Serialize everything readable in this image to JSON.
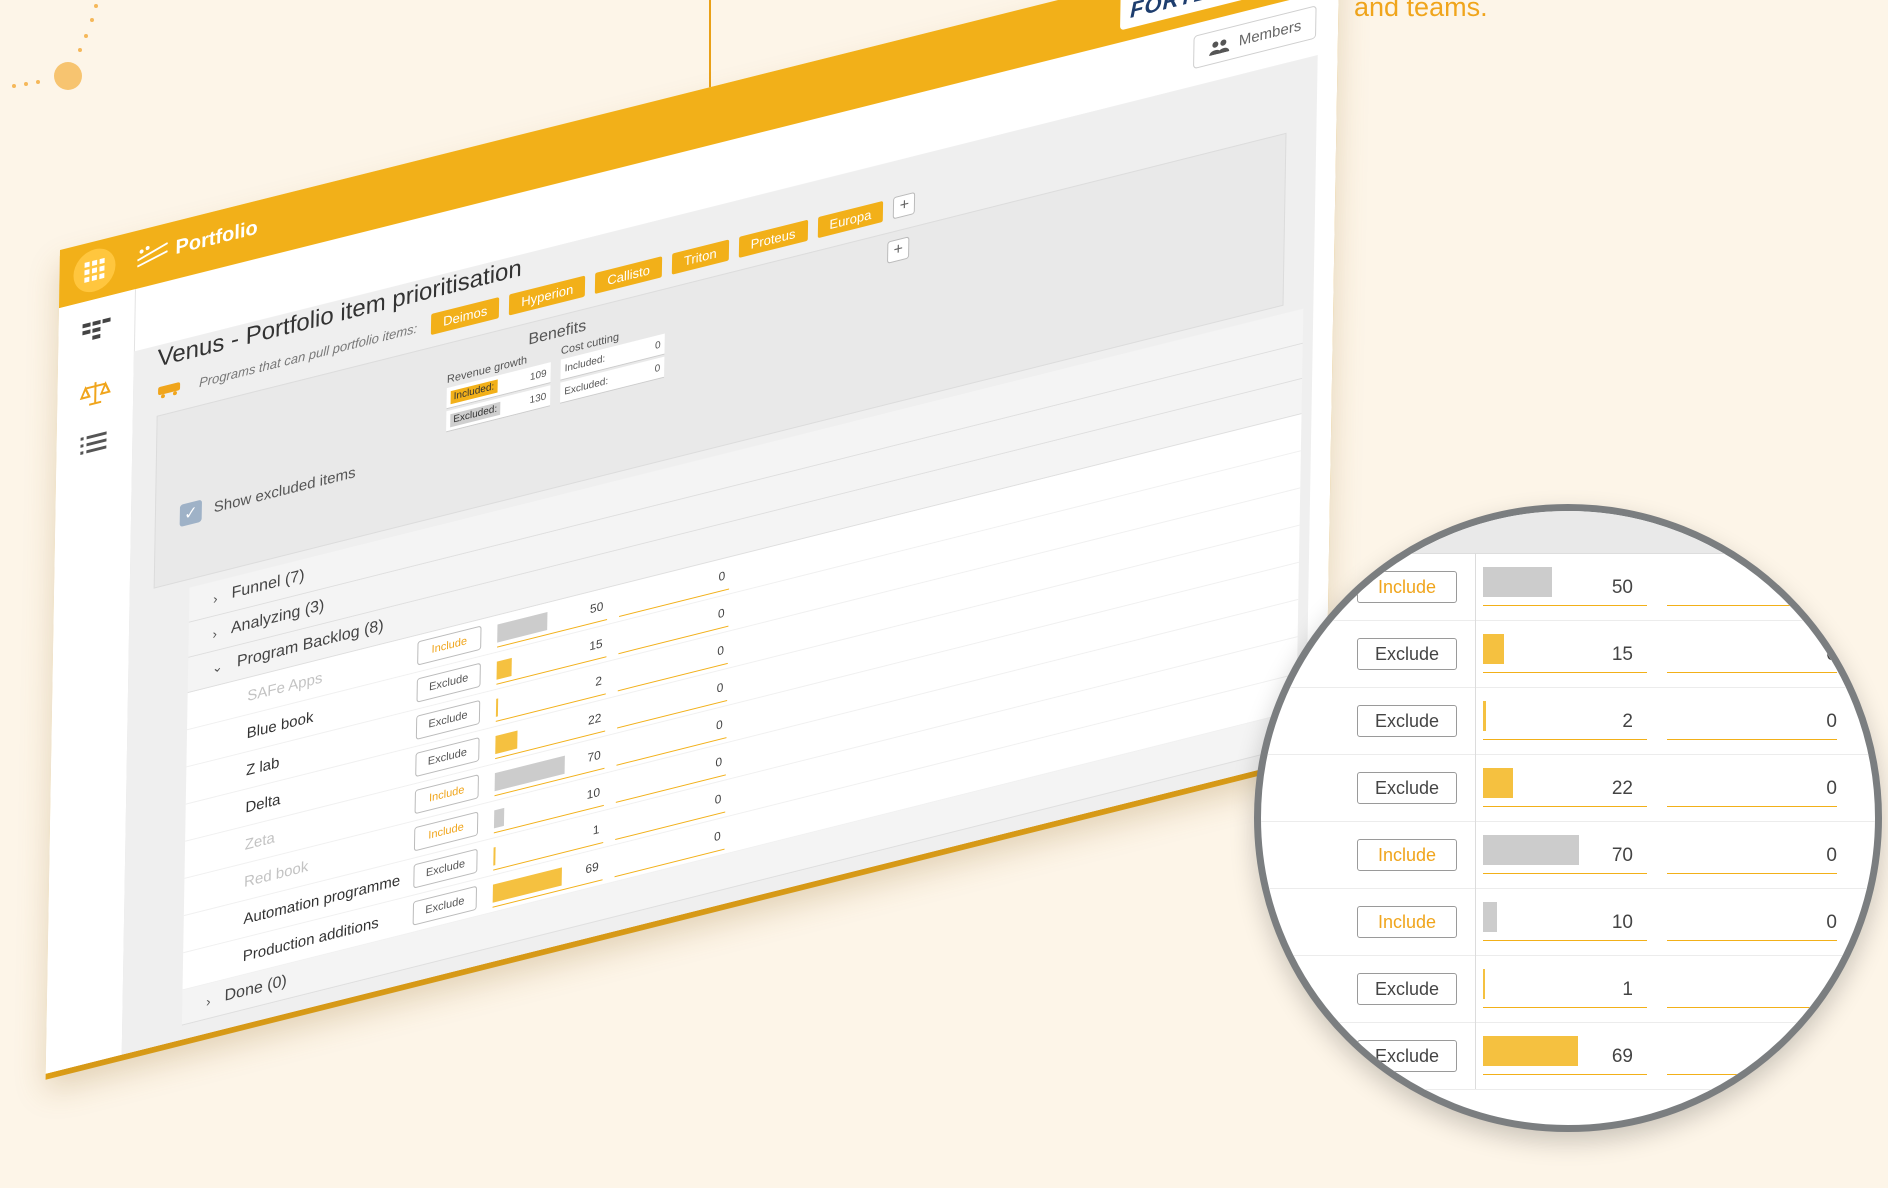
{
  "caption": "and teams.",
  "app": {
    "section_title": "Portfolio",
    "brand": "FORTES",
    "members_label": "Members"
  },
  "page": {
    "title": "Venus - Portfolio item prioritisation",
    "programs_label": "Programs that can pull portfolio items:",
    "programs": [
      "Deimos",
      "Hyperion",
      "Callisto",
      "Triton",
      "Proteus",
      "Europa"
    ],
    "show_excluded_label": "Show excluded items"
  },
  "benefits": {
    "title": "Benefits",
    "columns": [
      {
        "name": "Revenue growth",
        "included_label": "Included:",
        "included": "109",
        "excluded_label": "Excluded:",
        "excluded": "130"
      },
      {
        "name": "Cost cutting",
        "included_label": "Included:",
        "included": "0",
        "excluded_label": "Excluded:",
        "excluded": "0"
      }
    ]
  },
  "groups": [
    {
      "label": "Funnel (7)",
      "expanded": false
    },
    {
      "label": "Analyzing (3)",
      "expanded": false
    },
    {
      "label": "Program Backlog (8)",
      "expanded": true
    },
    {
      "label": "Done (0)",
      "expanded": false
    }
  ],
  "items": [
    {
      "name": "SAFe Apps",
      "action": "Include",
      "excluded": true,
      "value": 50,
      "value_label": "50",
      "cost": "0"
    },
    {
      "name": "Blue book",
      "action": "Exclude",
      "excluded": false,
      "value": 15,
      "value_label": "15",
      "cost": "0"
    },
    {
      "name": "Z lab",
      "action": "Exclude",
      "excluded": false,
      "value": 2,
      "value_label": "2",
      "cost": "0"
    },
    {
      "name": "Delta",
      "action": "Exclude",
      "excluded": false,
      "value": 22,
      "value_label": "22",
      "cost": "0"
    },
    {
      "name": "Zeta",
      "action": "Include",
      "excluded": true,
      "value": 70,
      "value_label": "70",
      "cost": "0"
    },
    {
      "name": "Red book",
      "action": "Include",
      "excluded": true,
      "value": 10,
      "value_label": "10",
      "cost": "0"
    },
    {
      "name": "Automation programme",
      "action": "Exclude",
      "excluded": false,
      "value": 1,
      "value_label": "1",
      "cost": "0"
    },
    {
      "name": "Production additions",
      "action": "Exclude",
      "excluded": false,
      "value": 69,
      "value_label": "69",
      "cost": "0"
    }
  ],
  "colors": {
    "accent": "#f2b019",
    "excluded_bar": "#cccccc",
    "included_bar": "#f5c140"
  }
}
